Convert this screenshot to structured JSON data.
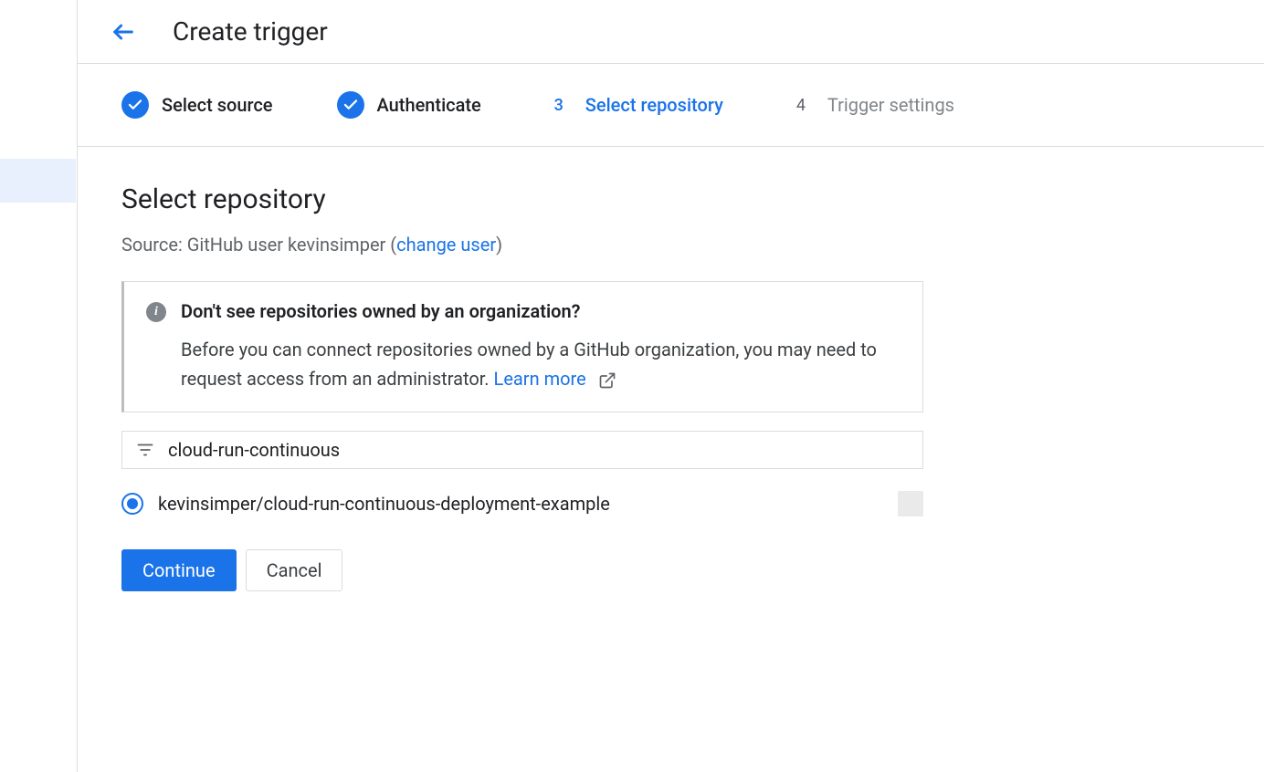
{
  "header": {
    "title": "Create trigger"
  },
  "stepper": {
    "steps": [
      {
        "label": "Select source",
        "state": "done"
      },
      {
        "label": "Authenticate",
        "state": "done"
      },
      {
        "num": "3",
        "label": "Select repository",
        "state": "active"
      },
      {
        "num": "4",
        "label": "Trigger settings",
        "state": "upcoming"
      }
    ]
  },
  "section": {
    "title": "Select repository",
    "source_prefix": "Source: GitHub user kevinsimper (",
    "change_user": "change user",
    "source_suffix": ")"
  },
  "info": {
    "title": "Don't see repositories owned by an organization?",
    "body": "Before you can connect repositories owned by a GitHub organization, you may need to request access from an administrator. ",
    "learn_more": "Learn more"
  },
  "filter": {
    "value": "cloud-run-continuous"
  },
  "repo": {
    "label": "kevinsimper/cloud-run-continuous-deployment-example"
  },
  "buttons": {
    "continue": "Continue",
    "cancel": "Cancel"
  }
}
